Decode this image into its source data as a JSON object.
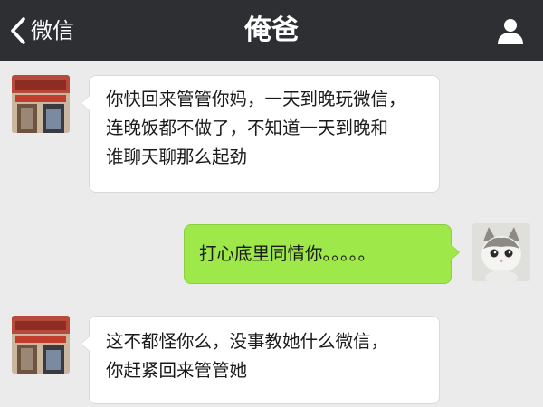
{
  "header": {
    "back_label": "微信",
    "title": "俺爸"
  },
  "messages": [
    {
      "sender": "contact",
      "lines": [
        "你快回来管管你妈，一天到晚玩微信，",
        "连晚饭都不做了，不知道一天到晚和",
        "谁聊天聊那么起劲"
      ]
    },
    {
      "sender": "me",
      "lines": [
        "打心底里同情你。。。。。"
      ]
    },
    {
      "sender": "contact",
      "lines": [
        "这不都怪你么，没事教她什么微信，",
        "你赶紧回来管管她"
      ]
    }
  ],
  "colors": {
    "header_bg": "#2d2f33",
    "chat_bg": "#ebebeb",
    "bubble_contact": "#ffffff",
    "bubble_me": "#9ee84a"
  },
  "icons": {
    "back": "chevron-left-icon",
    "profile": "person-icon"
  }
}
